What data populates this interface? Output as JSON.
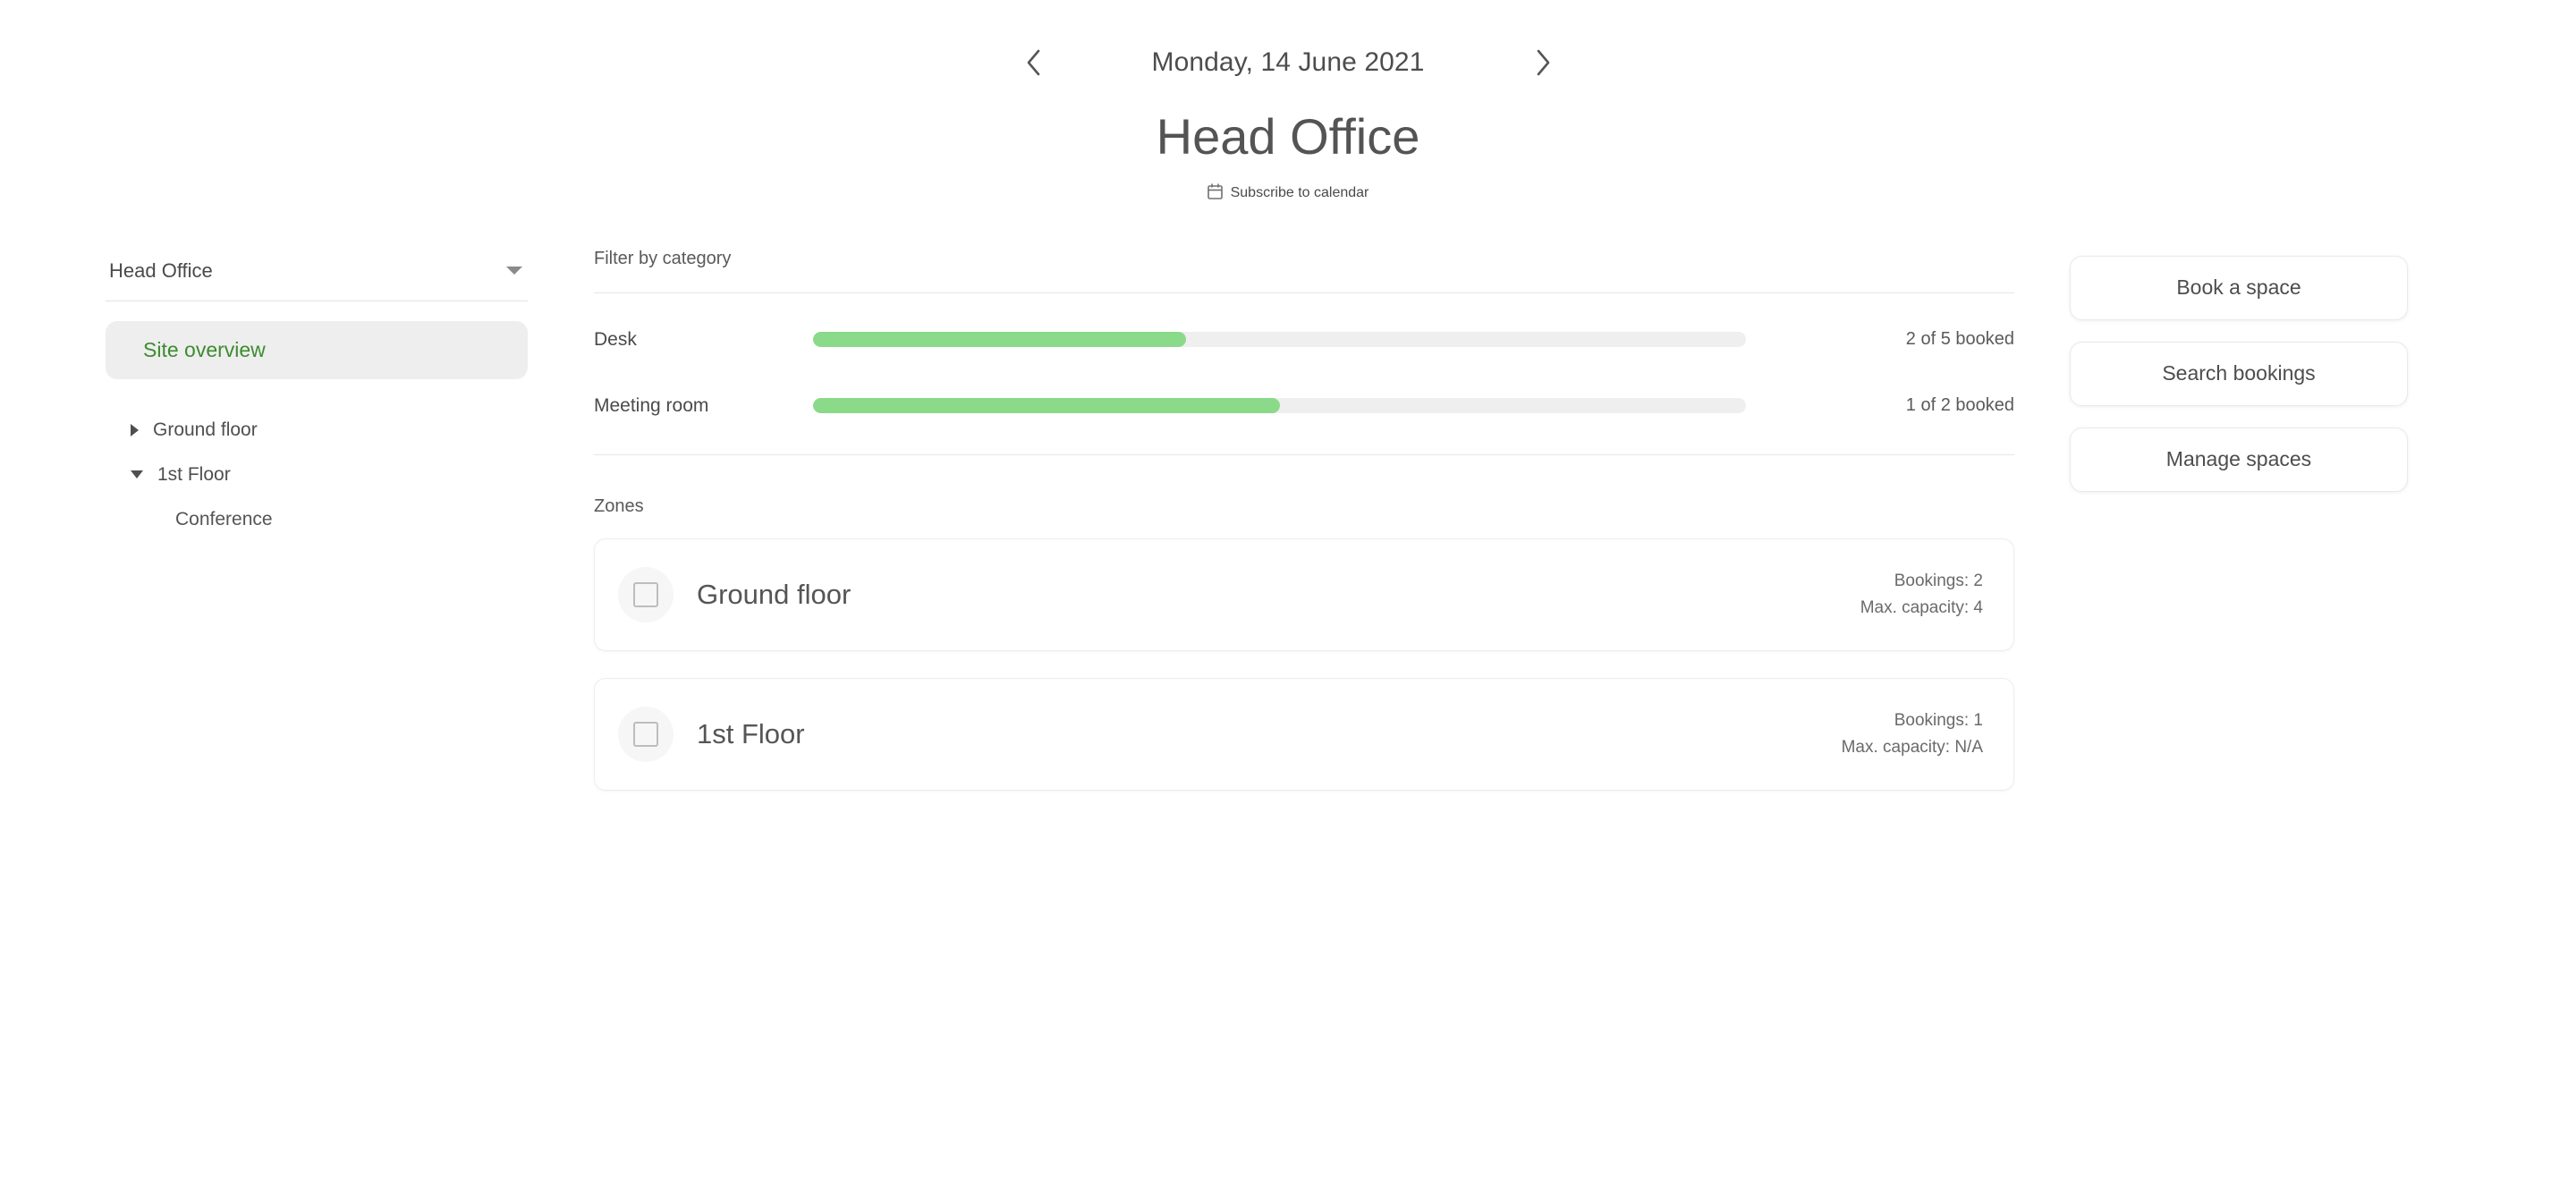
{
  "header": {
    "prev_icon": "chevron-left-icon",
    "next_icon": "chevron-right-icon",
    "date": "Monday, 14 June 2021",
    "site_title": "Head Office",
    "subscribe_icon": "calendar-icon",
    "subscribe_label": "Subscribe to calendar"
  },
  "sidebar": {
    "site_selector": {
      "label": "Head Office",
      "caret_icon": "chevron-down-icon"
    },
    "active_item": "Site overview",
    "tree": [
      {
        "label": "Ground floor",
        "expanded": false,
        "icon": "triangle-right-icon"
      },
      {
        "label": "1st Floor",
        "expanded": true,
        "icon": "triangle-down-icon"
      }
    ],
    "children": [
      {
        "label": "Conference"
      }
    ]
  },
  "main": {
    "filter_label": "Filter by category",
    "zones_label": "Zones",
    "categories": [
      {
        "name": "Desk",
        "booked": 2,
        "total": 5,
        "count_text": "2 of 5 booked",
        "percent": 40
      },
      {
        "name": "Meeting room",
        "booked": 1,
        "total": 2,
        "count_text": "1 of 2 booked",
        "percent": 50
      }
    ],
    "zones": [
      {
        "name": "Ground floor",
        "icon": "zone-square-icon",
        "bookings_text": "Bookings: 2",
        "capacity_text": "Max. capacity: 4"
      },
      {
        "name": "1st Floor",
        "icon": "zone-square-icon",
        "bookings_text": "Bookings: 1",
        "capacity_text": "Max. capacity: N/A"
      }
    ]
  },
  "actions": [
    {
      "label": "Book a space"
    },
    {
      "label": "Search bookings"
    },
    {
      "label": "Manage spaces"
    }
  ],
  "colors": {
    "accent_green": "#3d8b2f",
    "bar_fill": "#8ada8a",
    "bar_track": "#efefef",
    "text_primary": "#4a4a4a"
  }
}
